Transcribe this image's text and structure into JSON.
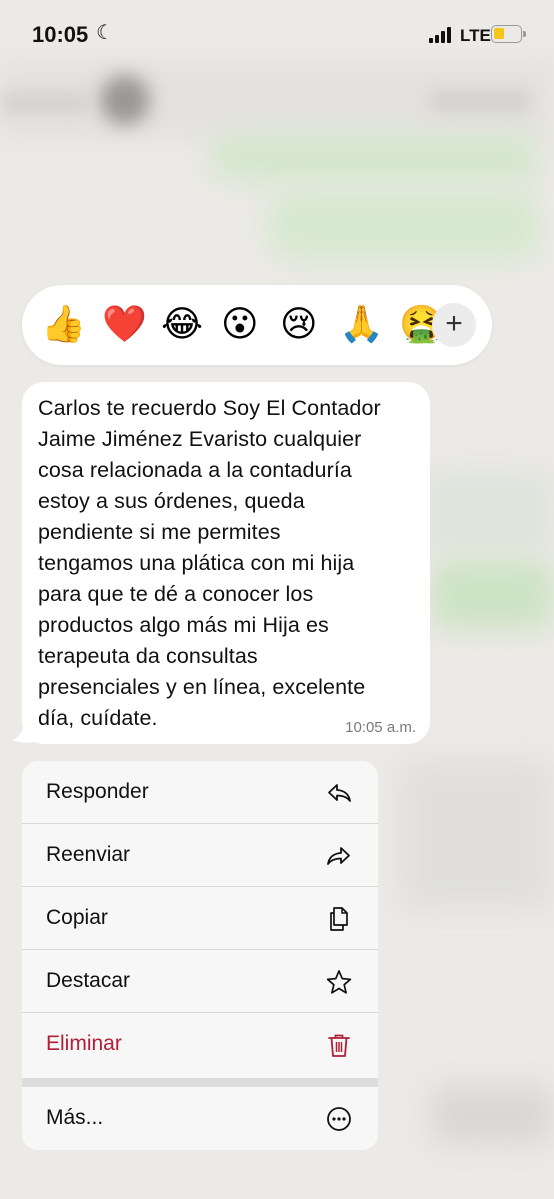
{
  "status_bar": {
    "time": "10:05",
    "network": "LTE",
    "battery_level": 0.45,
    "battery_color": "#f5c518"
  },
  "reactions": {
    "emojis": [
      "👍",
      "❤️",
      "😂",
      "😮",
      "😢",
      "🙏",
      "🤮"
    ],
    "more_icon": "plus-icon"
  },
  "message": {
    "lines": [
      "Carlos te recuerdo Soy El Contador",
      "Jaime Jiménez Evaristo cualquier",
      "cosa relacionada a la contaduría",
      "estoy a sus órdenes, queda",
      "pendiente si me permites",
      "tengamos una plática con mi hija",
      "para que te dé a conocer los",
      "productos algo más mi Hija es",
      "terapeuta da consultas",
      "presenciales y en línea, excelente",
      "día, cuídate."
    ],
    "time": "10:05 a.m."
  },
  "menu": {
    "items": [
      {
        "label": "Responder",
        "icon": "reply-icon"
      },
      {
        "label": "Reenviar",
        "icon": "forward-icon"
      },
      {
        "label": "Copiar",
        "icon": "copy-icon"
      },
      {
        "label": "Destacar",
        "icon": "star-icon"
      },
      {
        "label": "Eliminar",
        "icon": "trash-icon"
      }
    ],
    "more": {
      "label": "Más...",
      "icon": "more-icon"
    },
    "danger_color": "#b01f35"
  }
}
